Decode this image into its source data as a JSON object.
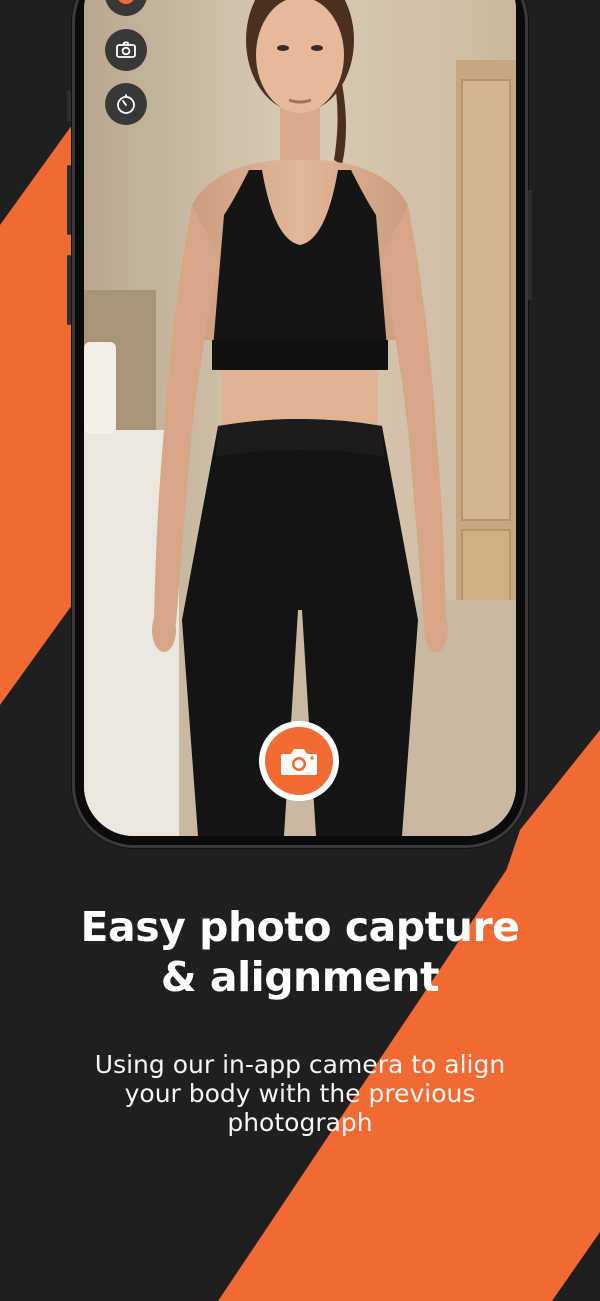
{
  "headline": {
    "line1": "Easy photo capture",
    "line2": "& alignment"
  },
  "subtext": {
    "line1": "Using our in-app camera to align",
    "line2": "your body with the previous",
    "line3": "photograph"
  },
  "camera_controls": [
    {
      "icon": "flash-icon"
    },
    {
      "icon": "switch-camera-icon"
    },
    {
      "icon": "timer-icon"
    }
  ],
  "shutter": {
    "icon": "camera-icon"
  },
  "colors": {
    "background": "#1f1f21",
    "accent": "#f26a33",
    "text": "#ffffff"
  }
}
